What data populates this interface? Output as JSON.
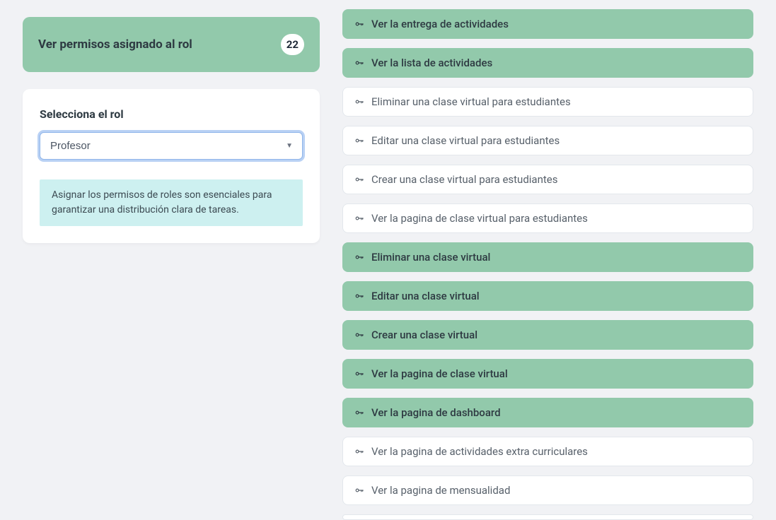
{
  "header": {
    "title": "Ver permisos asignado al rol",
    "count": "22"
  },
  "selector": {
    "label": "Selecciona el rol",
    "value": "Profesor",
    "note": "Asignar los permisos de roles son esenciales para garantizar una distribución clara de tareas."
  },
  "perm_overflow_top": {
    "label": "",
    "granted": true
  },
  "permissions": [
    {
      "label": "Ver la entrega de actividades",
      "granted": true
    },
    {
      "label": "Ver la lista de actividades",
      "granted": true
    },
    {
      "label": "Eliminar una clase virtual para estudiantes",
      "granted": false
    },
    {
      "label": "Editar una clase virtual para estudiantes",
      "granted": false
    },
    {
      "label": "Crear una clase virtual para estudiantes",
      "granted": false
    },
    {
      "label": "Ver la pagina de clase virtual para estudiantes",
      "granted": false
    },
    {
      "label": "Eliminar una clase virtual",
      "granted": true
    },
    {
      "label": "Editar una clase virtual",
      "granted": true
    },
    {
      "label": "Crear una clase virtual",
      "granted": true
    },
    {
      "label": "Ver la pagina de clase virtual",
      "granted": true
    },
    {
      "label": "Ver la pagina de dashboard",
      "granted": true
    },
    {
      "label": "Ver la pagina de actividades extra curriculares",
      "granted": false
    },
    {
      "label": "Ver la pagina de mensualidad",
      "granted": false
    }
  ],
  "perm_overflow_bottom": {
    "label": "",
    "granted": false
  }
}
